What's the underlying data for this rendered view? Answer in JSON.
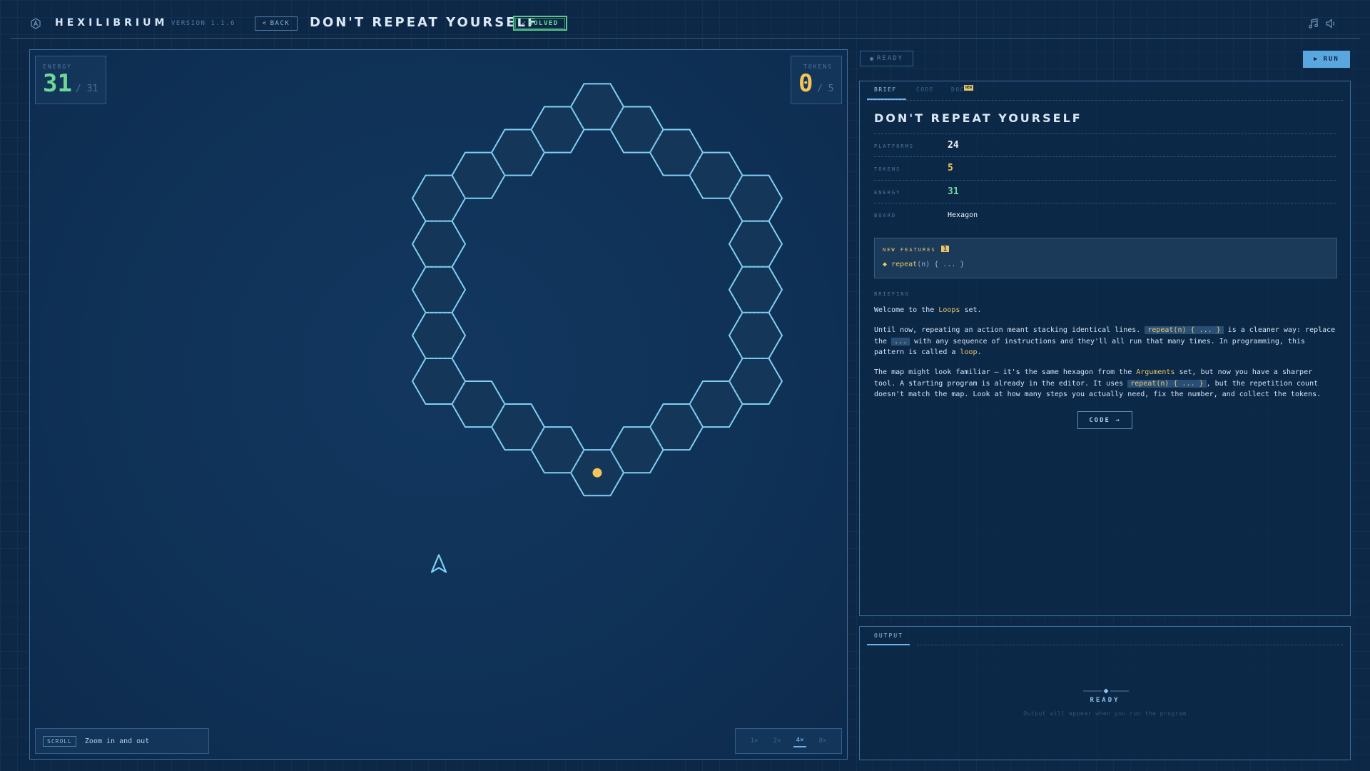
{
  "app": {
    "title": "HEXILIBRIUM",
    "version": "VERSION 1.1.6",
    "back_label": "BACK",
    "level_title": "DON'T REPEAT YOURSELF",
    "solved_label": "SOLVED"
  },
  "stats": {
    "energy_label": "ENERGY",
    "energy_value": "31",
    "energy_total": "/ 31",
    "tokens_label": "TOKENS",
    "tokens_value": "0",
    "tokens_total": "/ 5"
  },
  "board": {
    "tiles": 24,
    "tokens": 5,
    "tile_fill": "#143659",
    "tile_stroke": "#7fd0f5",
    "token_color": "#f2c45a",
    "player_icon": "arrow-up-icon"
  },
  "scroll_hint": {
    "key": "SCROLL",
    "text": "Zoom in and out"
  },
  "zoom": {
    "options": [
      "1×",
      "2×",
      "4×",
      "8×"
    ],
    "selected": "4×"
  },
  "status": {
    "ready_label": "READY"
  },
  "run_label": "RUN",
  "tabs": {
    "brief": "BRIEF",
    "code": "CODE",
    "doc": "DOC",
    "new_badge": "NEW"
  },
  "brief": {
    "title": "DON'T REPEAT YOURSELF",
    "rows": [
      {
        "label": "PLATFORMS",
        "value": "24"
      },
      {
        "label": "TOKENS",
        "value": "5"
      },
      {
        "label": "ENERGY",
        "value": "31"
      },
      {
        "label": "BOARD",
        "value": "Hexagon"
      }
    ],
    "features_label": "NEW FEATURES",
    "features_count": "1",
    "feature_keyword": "repeat",
    "feature_args": "(n) { ... }",
    "briefing_label": "BRIEFING",
    "p1_a": "Welcome to the ",
    "p1_hl": "Loops",
    "p1_b": " set.",
    "p2_a": "Until now, repeating an action meant stacking identical lines. ",
    "p2_code1": "repeat(n) { ... }",
    "p2_b": " is a cleaner way: replace the ",
    "p2_code2": "...",
    "p2_c": " with any sequence of instructions and they'll all run that many times. In programming, this pattern is called a ",
    "p2_hl": "loop",
    "p2_d": ".",
    "p3_a": "The map might look familiar — it's the same hexagon from the ",
    "p3_hl": "Arguments",
    "p3_b": " set, but now you have a sharper tool. A starting program is already in the editor. It uses ",
    "p3_code": "repeat(n) { ... }",
    "p3_c": ", but the repetition count doesn't match the map. Look at how many steps you actually need, fix the number, and collect the tokens.",
    "code_button": "CODE →"
  },
  "output": {
    "tab": "OUTPUT",
    "ready": "READY",
    "hint": "Output will appear when you run the program"
  }
}
